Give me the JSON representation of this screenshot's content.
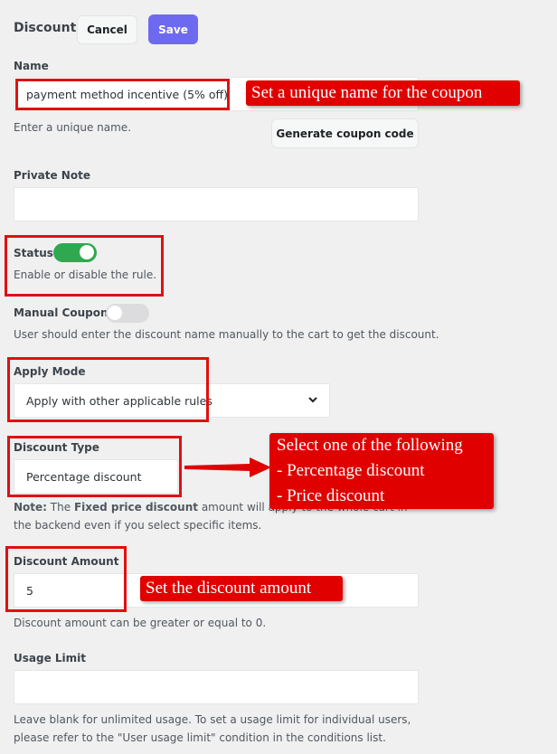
{
  "header": {
    "title": "Discount",
    "cancel_label": "Cancel",
    "save_label": "Save"
  },
  "name": {
    "label": "Name",
    "value": "payment method incentive (5% off)",
    "help": "Enter a unique name.",
    "generate_label": "Generate coupon code"
  },
  "private_note": {
    "label": "Private Note",
    "value": ""
  },
  "status": {
    "label": "Status",
    "enabled": true,
    "help": "Enable or disable the rule."
  },
  "manual_coupon": {
    "label": "Manual Coupon",
    "enabled": false,
    "help": "User should enter the discount name manually to the cart to get the discount."
  },
  "apply_mode": {
    "label": "Apply Mode",
    "selected": "Apply with other applicable rules"
  },
  "discount_type": {
    "label": "Discount Type",
    "selected": "Percentage discount",
    "note_prefix": "Note:",
    "note_the": "The",
    "note_bold": "Fixed price discount",
    "note_rest": "amount will apply to the whole cart in the backend even if you select specific items."
  },
  "discount_amount": {
    "label": "Discount Amount",
    "value": "5",
    "help": "Discount amount can be greater or equal to 0."
  },
  "usage_limit": {
    "label": "Usage Limit",
    "value": "",
    "help": "Leave blank for unlimited usage. To set a usage limit for individual users, please refer to the \"User usage limit\" condition in the conditions list."
  },
  "annotations": {
    "name_callout": "Set a unique name for the coupon",
    "type_callout_line1": "Select one of the following",
    "type_callout_line2": "- Percentage discount",
    "type_callout_line3": "- Price discount",
    "amount_callout": "Set the discount amount"
  },
  "colors": {
    "accent": "#6e6af0",
    "toggle_on": "#2fa84f",
    "annotation_red": "#e10000",
    "background": "#f0f0f1"
  }
}
